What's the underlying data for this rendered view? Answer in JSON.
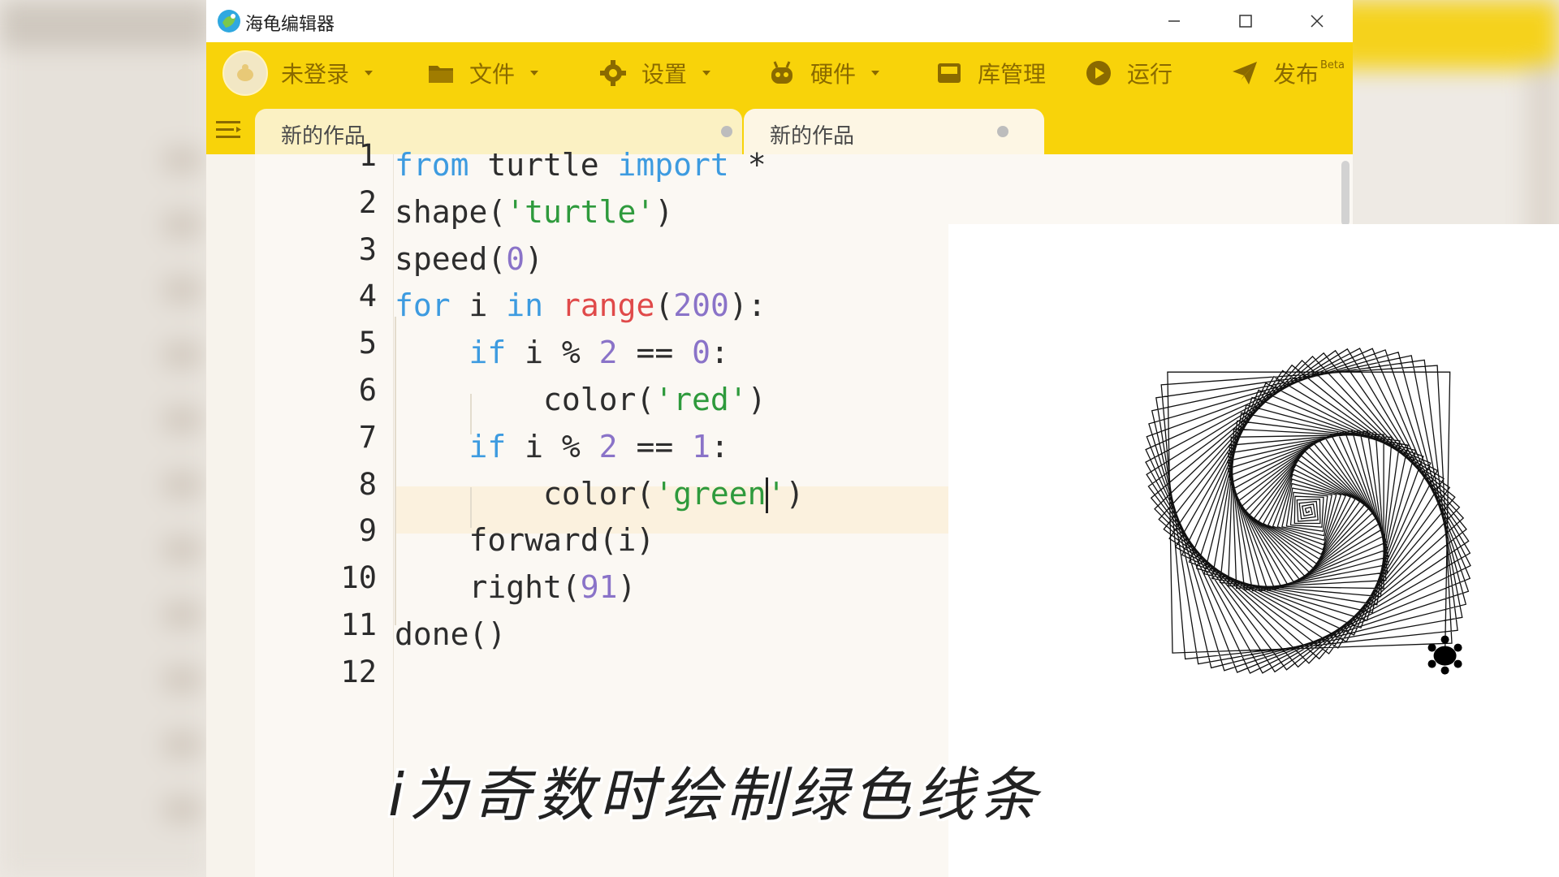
{
  "app": {
    "title": "海龟编辑器"
  },
  "window_controls": {
    "minimize": "minimize-icon",
    "maximize": "maximize-icon",
    "close": "close-icon"
  },
  "menubar": {
    "login": "未登录",
    "file": "文件",
    "settings": "设置",
    "hardware": "硬件",
    "library": "库管理",
    "run": "运行",
    "publish": "发布",
    "publish_badge": "Beta"
  },
  "tabs": [
    {
      "label": "新的作品"
    },
    {
      "label": "新的作品"
    }
  ],
  "editor": {
    "line_numbers": [
      "1",
      "2",
      "3",
      "4",
      "5",
      "6",
      "7",
      "8",
      "9",
      "10",
      "11",
      "12"
    ],
    "lines": [
      [
        {
          "t": "from",
          "c": "kw"
        },
        {
          "t": " turtle ",
          "c": ""
        },
        {
          "t": "import",
          "c": "kw"
        },
        {
          "t": " *",
          "c": ""
        }
      ],
      [
        {
          "t": "shape(",
          "c": ""
        },
        {
          "t": "'turtle'",
          "c": "str"
        },
        {
          "t": ")",
          "c": ""
        }
      ],
      [
        {
          "t": "speed(",
          "c": ""
        },
        {
          "t": "0",
          "c": "num"
        },
        {
          "t": ")",
          "c": ""
        }
      ],
      [
        {
          "t": "for",
          "c": "kw"
        },
        {
          "t": " i ",
          "c": ""
        },
        {
          "t": "in",
          "c": "kw"
        },
        {
          "t": " ",
          "c": ""
        },
        {
          "t": "range",
          "c": "fn-red"
        },
        {
          "t": "(",
          "c": ""
        },
        {
          "t": "200",
          "c": "num"
        },
        {
          "t": "):",
          "c": ""
        }
      ],
      [
        {
          "t": "    ",
          "c": ""
        },
        {
          "t": "if",
          "c": "kw"
        },
        {
          "t": " i % ",
          "c": ""
        },
        {
          "t": "2",
          "c": "num"
        },
        {
          "t": " == ",
          "c": ""
        },
        {
          "t": "0",
          "c": "num"
        },
        {
          "t": ":",
          "c": ""
        }
      ],
      [
        {
          "t": "        color(",
          "c": ""
        },
        {
          "t": "'red'",
          "c": "str"
        },
        {
          "t": ")",
          "c": ""
        }
      ],
      [
        {
          "t": "    ",
          "c": ""
        },
        {
          "t": "if",
          "c": "kw"
        },
        {
          "t": " i % ",
          "c": ""
        },
        {
          "t": "2",
          "c": "num"
        },
        {
          "t": " == ",
          "c": ""
        },
        {
          "t": "1",
          "c": "num"
        },
        {
          "t": ":",
          "c": ""
        }
      ],
      [
        {
          "t": "        color(",
          "c": ""
        },
        {
          "t": "'green",
          "c": "str"
        },
        {
          "t": "|",
          "c": "cursor"
        },
        {
          "t": "'",
          "c": "str"
        },
        {
          "t": ")",
          "c": ""
        }
      ],
      [
        {
          "t": "    forward(i)",
          "c": ""
        }
      ],
      [
        {
          "t": "    right(",
          "c": ""
        },
        {
          "t": "91",
          "c": "num"
        },
        {
          "t": ")",
          "c": ""
        }
      ],
      [
        {
          "t": "done()",
          "c": ""
        }
      ],
      []
    ]
  },
  "turtle": {
    "steps": 200,
    "angle": 91
  },
  "subtitle": "i为奇数时绘制绿色线条",
  "colors": {
    "menubar": "#f8d30a",
    "keyword": "#3d9be0",
    "string": "#2e9a3c",
    "number": "#8a73c8",
    "builtin": "#e04a4a"
  }
}
